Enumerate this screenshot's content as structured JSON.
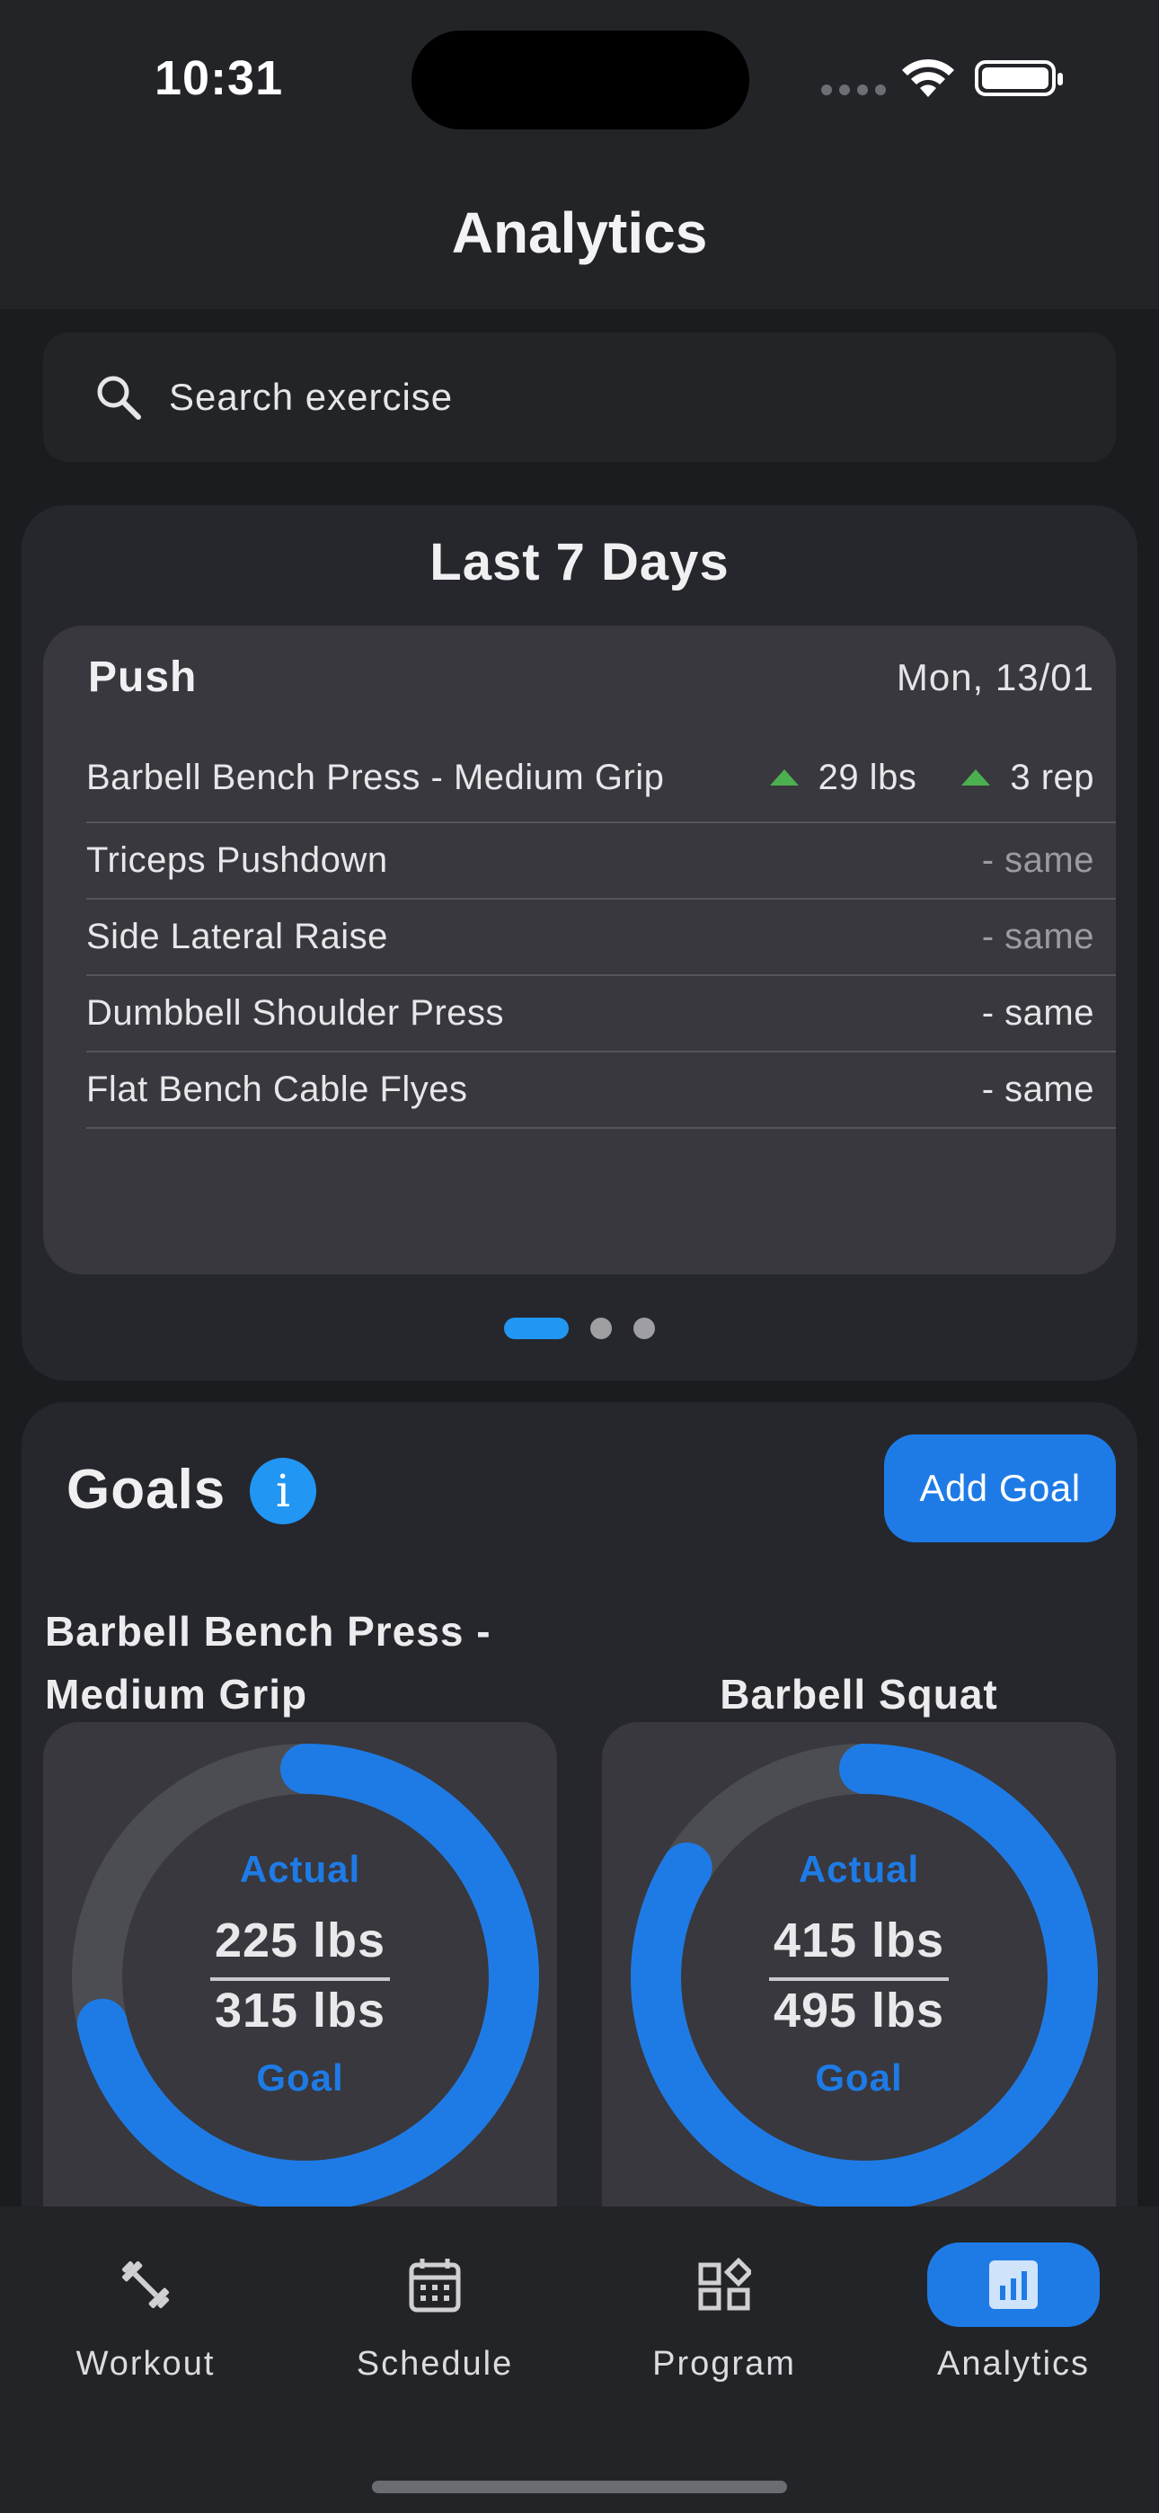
{
  "status_bar": {
    "time": "10:31"
  },
  "header": {
    "title": "Analytics"
  },
  "search": {
    "placeholder": "Search exercise"
  },
  "last7": {
    "title": "Last 7 Days",
    "workout": {
      "name": "Push",
      "date": "Mon, 13/01",
      "exercises": [
        {
          "name": "Barbell Bench Press - Medium Grip",
          "weight": "29 lbs",
          "reps": "3 rep"
        },
        {
          "name": "Triceps Pushdown",
          "change": "- same"
        },
        {
          "name": "Side Lateral Raise",
          "change": "- same"
        },
        {
          "name": "Dumbbell Shoulder Press",
          "change": "- same"
        },
        {
          "name": "Flat Bench Cable Flyes",
          "change": "- same"
        }
      ]
    },
    "pager": {
      "pages": 3,
      "active": 1
    }
  },
  "goals": {
    "title": "Goals",
    "info_icon": "i",
    "add_label": "Add Goal",
    "items": [
      {
        "name": "Barbell Bench Press - Medium Grip",
        "actual_label": "Actual",
        "actual": "225 lbs",
        "goal": "315 lbs",
        "goal_label": "Goal",
        "progress": 0.714
      },
      {
        "name": "Barbell Squat",
        "actual_label": "Actual",
        "actual": "415 lbs",
        "goal": "495 lbs",
        "goal_label": "Goal",
        "progress": 0.838
      }
    ]
  },
  "nav": {
    "items": [
      {
        "label": "Workout",
        "icon": "dumbbell-icon"
      },
      {
        "label": "Schedule",
        "icon": "calendar-icon"
      },
      {
        "label": "Program",
        "icon": "grid-shapes-icon"
      },
      {
        "label": "Analytics",
        "icon": "bar-chart-icon",
        "active": true
      }
    ]
  },
  "colors": {
    "accent": "#1e7be6",
    "increase": "#4caf50",
    "background": "#1b1c20"
  }
}
